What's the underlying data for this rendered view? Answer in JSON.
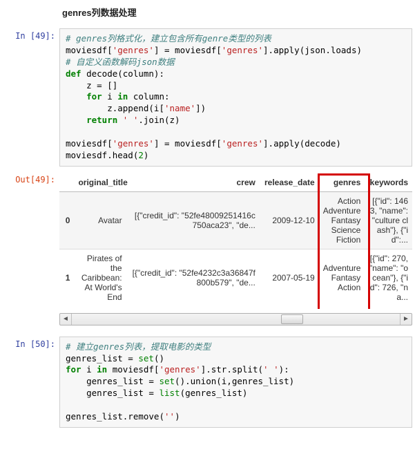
{
  "heading": "genres列数据处理",
  "cells": {
    "in49": {
      "prompt": "In [49]:",
      "code": {
        "c1": "# genres列格式化，建立包含所有genre类型的列表",
        "l2a": "moviesdf[",
        "l2s1": "'genres'",
        "l2b": "] = moviesdf[",
        "l2s2": "'genres'",
        "l2c": "].apply(json.loads)",
        "c2": "# 自定义函数解码json数据",
        "def": "def",
        "fn": " decode(column):",
        "l5": "    z = []",
        "for": "for",
        "l6": " i ",
        "in": "in",
        "l6b": " column:",
        "l7a": "        z.append(i[",
        "l7s": "'name'",
        "l7b": "])",
        "ret": "return",
        "l8a": " ",
        "l8s": "' '",
        "l8b": ".join(z)",
        "blank": "",
        "l10a": "moviesdf[",
        "l10s1": "'genres'",
        "l10b": "] = moviesdf[",
        "l10s2": "'genres'",
        "l10c": "].apply(decode)",
        "l11a": "moviesdf.head(",
        "l11n": "2",
        "l11b": ")"
      }
    },
    "out49": {
      "prompt": "Out[49]:",
      "columns": [
        "original_title",
        "crew",
        "release_date",
        "genres",
        "keywords"
      ],
      "rows": [
        {
          "idx": "0",
          "original_title": "Avatar",
          "crew": "[{\"credit_id\": \"52fe48009251416c750aca23\", \"de...",
          "release_date": "2009-12-10",
          "genres": "Action Adventure Fantasy Science Fiction",
          "keywords": "[{\"id\": 1463, \"name\": \"culture clash\"}, {\"id\":..."
        },
        {
          "idx": "1",
          "original_title": "Pirates of the Caribbean: At World's End",
          "crew": "[{\"credit_id\": \"52fe4232c3a36847f800b579\", \"de...",
          "release_date": "2007-05-19",
          "genres": "Adventure Fantasy Action",
          "keywords": "[{\"id\": 270, \"name\": \"ocean\"}, {\"id\": 726, \"na..."
        }
      ]
    },
    "in50": {
      "prompt": "In [50]:",
      "code": {
        "c1": "# 建立genres列表，提取电影的类型",
        "l2a": "genres_list = ",
        "set": "set",
        "l2b": "()",
        "for": "for",
        "l3a": " i ",
        "in": "in",
        "l3b": " moviesdf[",
        "l3s": "'genres'",
        "l3c": "].str.split(",
        "l3s2": "' '",
        "l3d": "):",
        "l4a": "    genres_list = ",
        "set2": "set",
        "l4b": "().union(i,genres_list)",
        "l5a": "    genres_list = ",
        "list": "list",
        "l5b": "(genres_list)",
        "blank": "",
        "l7a": "genres_list.remove(",
        "l7s": "''",
        "l7b": ")"
      }
    }
  }
}
